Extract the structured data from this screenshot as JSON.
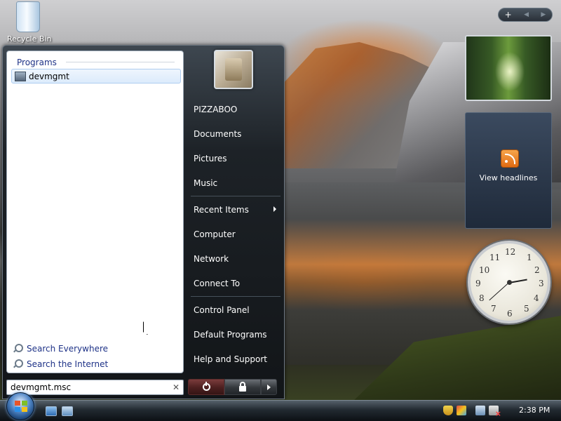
{
  "desktop": {
    "recycle_bin_label": "Recycle Bin"
  },
  "start_menu": {
    "programs_header": "Programs",
    "programs": [
      {
        "label": "devmgmt"
      }
    ],
    "search_links": [
      {
        "label": "Search Everywhere",
        "icon": "magnifier-icon"
      },
      {
        "label": "Search the Internet",
        "icon": "magnifier-icon"
      }
    ],
    "search_box_value": "devmgmt.msc",
    "search_clear_glyph": "✕",
    "right_items": [
      {
        "label": "PIZZABOO"
      },
      {
        "label": "Documents"
      },
      {
        "label": "Pictures"
      },
      {
        "label": "Music"
      },
      {
        "label": "Recent Items"
      },
      {
        "label": "Computer"
      },
      {
        "label": "Network"
      },
      {
        "label": "Connect To"
      },
      {
        "label": "Control Panel"
      },
      {
        "label": "Default Programs"
      },
      {
        "label": "Help and Support"
      }
    ]
  },
  "sidebar": {
    "controls": {
      "add": "+",
      "prev": "◀",
      "next": "▶"
    },
    "feed_label": "View headlines",
    "clock_numbers": [
      "12",
      "1",
      "2",
      "3",
      "4",
      "5",
      "6",
      "7",
      "8",
      "9",
      "10",
      "11"
    ]
  },
  "taskbar": {
    "clock_text": "2:38 PM"
  },
  "colors": {
    "start_menu_bg": "#1d2227",
    "link_blue": "#1e3287",
    "power_red": "#7a3b3b"
  }
}
